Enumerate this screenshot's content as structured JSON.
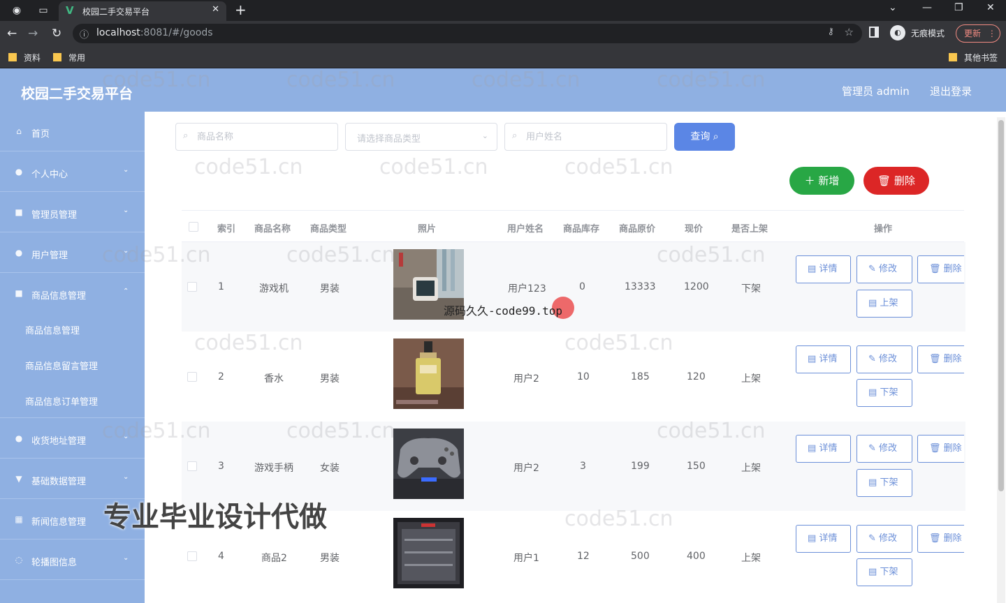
{
  "browser": {
    "tab_title": "校园二手交易平台",
    "url_host": "localhost",
    "url_path": ":8081/#/goods",
    "incognito_label": "无痕模式",
    "update_label": "更新",
    "bookmarks": [
      "资料",
      "常用"
    ],
    "other_bookmarks": "其他书签"
  },
  "header": {
    "title": "校园二手交易平台",
    "admin": "管理员 admin",
    "logout": "退出登录"
  },
  "sidebar": {
    "items": [
      {
        "label": "首页",
        "icon": "home-icon"
      },
      {
        "label": "个人中心",
        "icon": "user-icon"
      },
      {
        "label": "管理员管理",
        "icon": "admin-icon"
      },
      {
        "label": "用户管理",
        "icon": "users-icon"
      },
      {
        "label": "商品信息管理",
        "icon": "goods-icon"
      }
    ],
    "subitems": [
      "商品信息管理",
      "商品信息留言管理",
      "商品信息订单管理"
    ],
    "items_after": [
      {
        "label": "收货地址管理",
        "icon": "address-icon"
      },
      {
        "label": "基础数据管理",
        "icon": "data-icon"
      },
      {
        "label": "新闻信息管理",
        "icon": "news-icon"
      },
      {
        "label": "轮播图信息",
        "icon": "carousel-icon"
      }
    ]
  },
  "search": {
    "name_placeholder": "商品名称",
    "type_placeholder": "请选择商品类型",
    "user_placeholder": "用户姓名",
    "query_label": "查询"
  },
  "actions": {
    "add_label": "新增",
    "delete_label": "删除"
  },
  "table": {
    "headers": [
      "索引",
      "商品名称",
      "商品类型",
      "照片",
      "用户姓名",
      "商品库存",
      "商品原价",
      "现价",
      "是否上架",
      "操作"
    ],
    "rows": [
      {
        "index": "1",
        "name": "游戏机",
        "type": "男装",
        "user": "用户123",
        "stock": "0",
        "orig_price": "13333",
        "price": "1200",
        "status": "下架",
        "toggle": "上架"
      },
      {
        "index": "2",
        "name": "香水",
        "type": "男装",
        "user": "用户2",
        "stock": "10",
        "orig_price": "185",
        "price": "120",
        "status": "上架",
        "toggle": "下架"
      },
      {
        "index": "3",
        "name": "游戏手柄",
        "type": "女装",
        "user": "用户2",
        "stock": "3",
        "orig_price": "199",
        "price": "150",
        "status": "上架",
        "toggle": "下架"
      },
      {
        "index": "4",
        "name": "商品2",
        "type": "男装",
        "user": "用户1",
        "stock": "12",
        "orig_price": "500",
        "price": "400",
        "status": "上架",
        "toggle": "下架"
      }
    ],
    "op_labels": {
      "detail": "详情",
      "edit": "修改",
      "delete": "删除"
    }
  },
  "overlay": {
    "caption": "源码久久-code99.top",
    "promo": "专业毕业设计代做",
    "watermark": "code51.cn"
  }
}
